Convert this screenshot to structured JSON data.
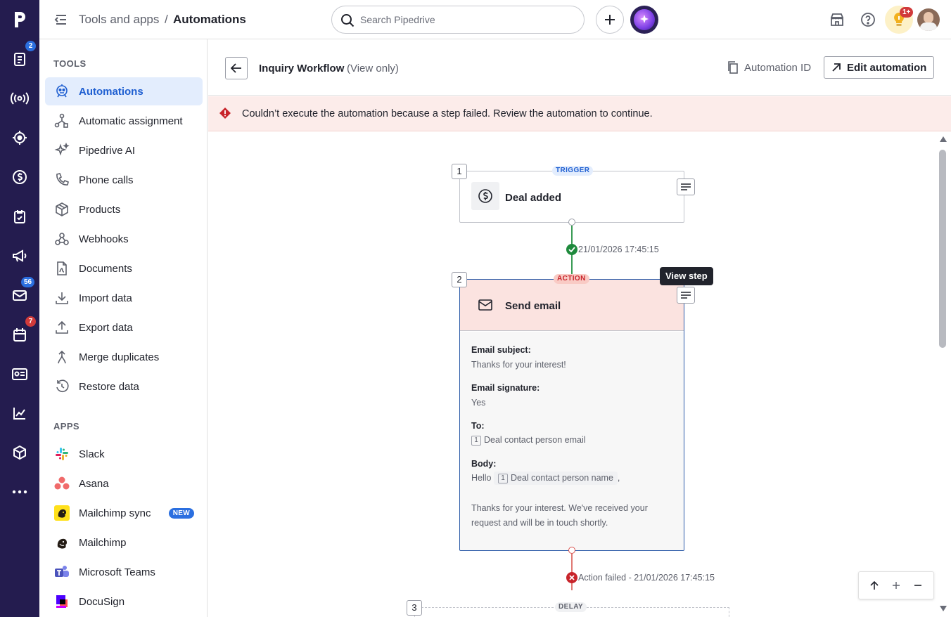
{
  "rail": {
    "badges": {
      "documents": "2",
      "mail": "56",
      "calendar": "7"
    }
  },
  "topbar": {
    "breadcrumb_parent": "Tools and apps",
    "breadcrumb_sep": "/",
    "breadcrumb_current": "Automations",
    "search_placeholder": "Search Pipedrive",
    "notif_badge": "1+"
  },
  "sidebar": {
    "tools_heading": "TOOLS",
    "tools": [
      {
        "label": "Automations",
        "icon": "automation-robot-icon"
      },
      {
        "label": "Automatic assignment",
        "icon": "assignment-icon"
      },
      {
        "label": "Pipedrive AI",
        "icon": "sparkle-icon"
      },
      {
        "label": "Phone calls",
        "icon": "phone-icon"
      },
      {
        "label": "Products",
        "icon": "box-icon"
      },
      {
        "label": "Webhooks",
        "icon": "webhook-icon"
      },
      {
        "label": "Documents",
        "icon": "document-icon"
      },
      {
        "label": "Import data",
        "icon": "download-icon"
      },
      {
        "label": "Export data",
        "icon": "upload-icon"
      },
      {
        "label": "Merge duplicates",
        "icon": "merge-icon"
      },
      {
        "label": "Restore data",
        "icon": "restore-icon"
      }
    ],
    "apps_heading": "APPS",
    "apps": [
      {
        "label": "Slack",
        "icon": "slack-icon"
      },
      {
        "label": "Asana",
        "icon": "asana-icon"
      },
      {
        "label": "Mailchimp sync",
        "icon": "mailchimp-icon",
        "badge": "NEW"
      },
      {
        "label": "Mailchimp",
        "icon": "mailchimp-icon"
      },
      {
        "label": "Microsoft Teams",
        "icon": "teams-icon"
      },
      {
        "label": "DocuSign",
        "icon": "docusign-icon"
      }
    ]
  },
  "workflow": {
    "title": "Inquiry Workflow",
    "mode": "(View only)",
    "automation_id_label": "Automation ID",
    "edit_label": "Edit automation"
  },
  "banner": {
    "message": "Couldn’t execute the automation because a step failed. Review the automation to continue."
  },
  "steps": {
    "trigger": {
      "number": "1",
      "tag": "TRIGGER",
      "title": "Deal added"
    },
    "trigger_status": "21/01/2026 17:45:15",
    "action": {
      "number": "2",
      "tag": "ACTION",
      "title": "Send email",
      "tooltip": "View step",
      "subject_label": "Email subject:",
      "subject_value": "Thanks for your interest!",
      "signature_label": "Email signature:",
      "signature_value": "Yes",
      "to_label": "To:",
      "to_chip": "1",
      "to_value": "Deal contact person email",
      "body_label": "Body:",
      "body_hello": "Hello",
      "body_chip": "1",
      "body_chip_value": "Deal contact person name",
      "body_comma": ",",
      "body_text": "Thanks for your interest. We've received your request and will be in touch shortly."
    },
    "action_status": "Action failed - 21/01/2026 17:45:15",
    "delay": {
      "number": "3",
      "tag": "DELAY"
    }
  },
  "colors": {
    "rail": "#241c4f",
    "accent": "#1f5fd1",
    "success": "#1e8a3c",
    "error": "#c8242b",
    "error_bg": "#fcecea"
  }
}
